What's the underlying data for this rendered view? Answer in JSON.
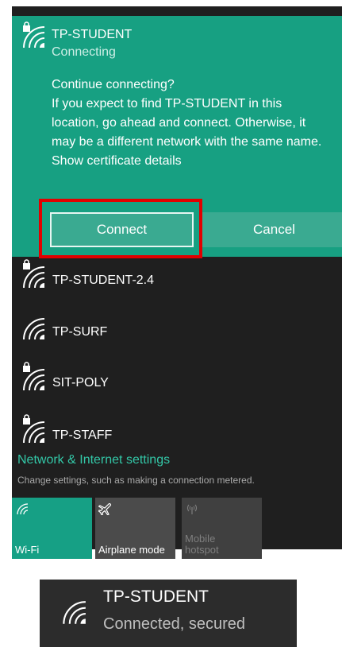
{
  "selected_network": {
    "name": "TP-STUDENT",
    "status": "Connecting",
    "prompt_lines": [
      "Continue connecting?",
      "If you expect to find TP-STUDENT in this location, go ahead and connect. Otherwise, it may be a different network with the same name.",
      "Show certificate details"
    ],
    "connect_label": "Connect",
    "cancel_label": "Cancel"
  },
  "networks": [
    {
      "name": "TP-STUDENT-2.4",
      "secured": true
    },
    {
      "name": "TP-SURF",
      "secured": false
    },
    {
      "name": "SIT-POLY",
      "secured": true
    },
    {
      "name": "TP-STAFF",
      "secured": true
    }
  ],
  "settings": {
    "title": "Network & Internet settings",
    "subtitle": "Change settings, such as making a connection metered."
  },
  "quick_actions": [
    {
      "label": "Wi-Fi",
      "icon": "wifi-icon"
    },
    {
      "label": "Airplane mode",
      "icon": "airplane-icon"
    },
    {
      "label_line1": "Mobile",
      "label_line2": "hotspot",
      "icon": "hotspot-icon"
    }
  ],
  "popup": {
    "name": "TP-STUDENT",
    "status": "Connected, secured"
  },
  "colors": {
    "accent": "#17a082",
    "panel": "#1f1f1f",
    "highlight": "#e10000"
  }
}
